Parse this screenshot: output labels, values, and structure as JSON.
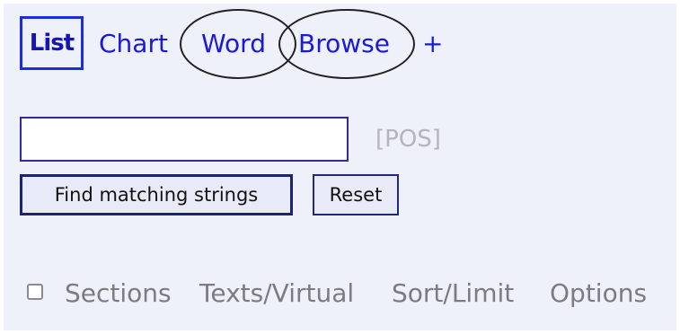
{
  "tabs": [
    {
      "label": "List",
      "active": true
    },
    {
      "label": "Chart"
    },
    {
      "label": "Word"
    },
    {
      "label": "Browse"
    },
    {
      "label": "+"
    }
  ],
  "search": {
    "value": "",
    "pos_label": "[POS]"
  },
  "buttons": {
    "find": "Find matching strings",
    "reset": "Reset"
  },
  "options": {
    "sections": "Sections",
    "texts_virtual": "Texts/Virtual",
    "sort_limit": "Sort/Limit",
    "options": "Options"
  },
  "colors": {
    "link": "#1a1ad6",
    "panel_bg": "#eef0fa",
    "muted_text": "#7b7b80"
  }
}
